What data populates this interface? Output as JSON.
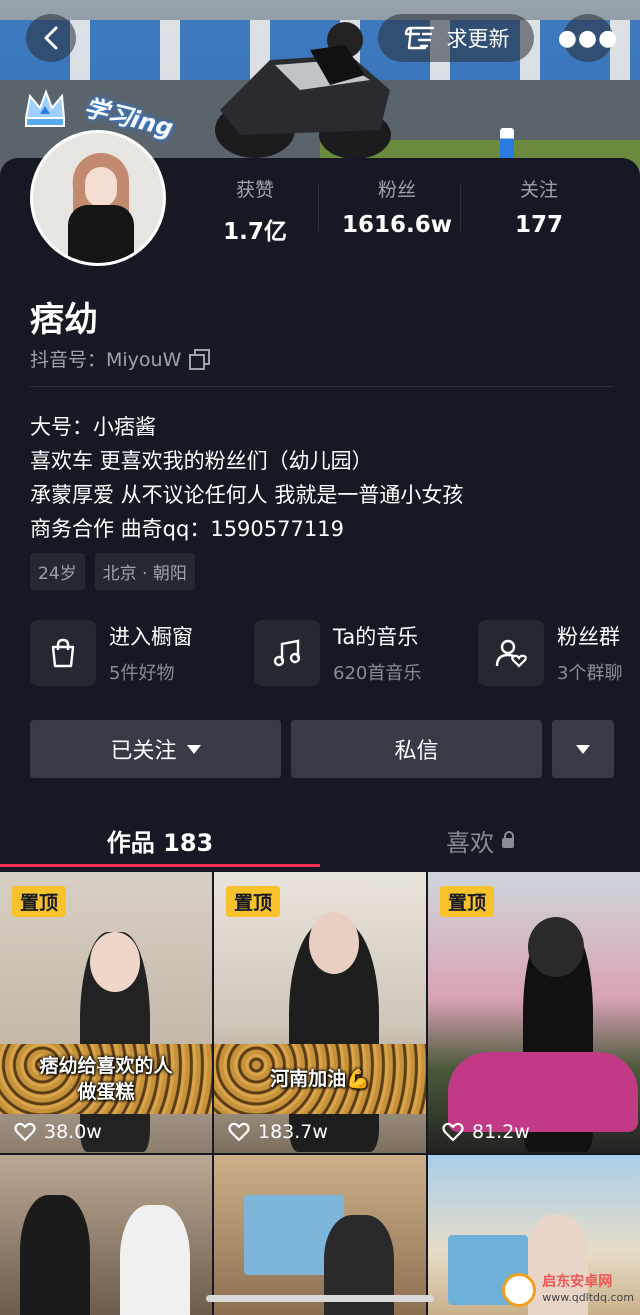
{
  "header": {
    "update_label": "求更新"
  },
  "profile": {
    "badge_text": "学习ing",
    "name": "痞幼",
    "douyin_id": "抖音号：MiyouW",
    "stats": [
      {
        "label": "获赞",
        "value": "1.7亿"
      },
      {
        "label": "粉丝",
        "value": "1616.6w"
      },
      {
        "label": "关注",
        "value": "177"
      }
    ],
    "bio": [
      "大号：小痞酱",
      "喜欢车 更喜欢我的粉丝们（幼儿园）",
      "承蒙厚爱 从不议论任何人 我就是一普通小女孩",
      "商务合作 曲奇qq：1590577119"
    ],
    "tags": [
      "24岁",
      "北京 · 朝阳"
    ]
  },
  "shortcuts": [
    {
      "title": "进入橱窗",
      "sub": "5件好物",
      "icon": "shopping-bag-icon"
    },
    {
      "title": "Ta的音乐",
      "sub": "620首音乐",
      "icon": "music-note-icon"
    },
    {
      "title": "粉丝群",
      "sub": "3个群聊",
      "icon": "fan-group-icon"
    }
  ],
  "actions": {
    "follow_label": "已关注",
    "message_label": "私信"
  },
  "tabs": {
    "works_label": "作品 183",
    "likes_label": "喜欢"
  },
  "videos": [
    {
      "pinned": "置顶",
      "caption": [
        "痞幼给喜欢的人",
        "做蛋糕"
      ],
      "likes": "38.0w"
    },
    {
      "pinned": "置顶",
      "caption": [
        "河南加油💪"
      ],
      "likes": "183.7w"
    },
    {
      "pinned": "置顶",
      "caption": [],
      "likes": "81.2w"
    }
  ],
  "watermark": {
    "title": "启东安卓网",
    "url": "www.qdltdq.com"
  },
  "colors": {
    "background": "#161823",
    "accent": "#fe2c55",
    "pin": "#f8c22d",
    "button": "#383a45"
  }
}
